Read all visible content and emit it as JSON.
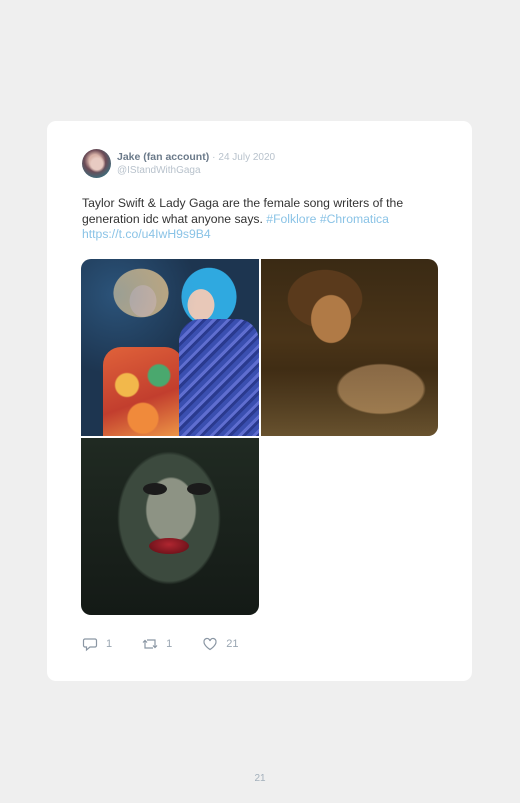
{
  "tweet": {
    "author_name": "Jake (fan account)",
    "separator": "·",
    "date": "24 July 2020",
    "handle": "@IStandWithGaga",
    "text_plain": "Taylor Swift & Lady Gaga are the female song writers of the generation idc what anyone says.",
    "hashtags": [
      "#Folklore",
      "#Chromatica"
    ],
    "link": "https://t.co/u4IwH9s9B4",
    "stats": {
      "replies": "1",
      "retweets": "1",
      "likes": "21"
    },
    "icons": {
      "reply": "reply-icon",
      "retweet": "retweet-icon",
      "like": "heart-icon"
    }
  },
  "page": {
    "number": "21"
  },
  "colors": {
    "background": "#efefef",
    "card": "#ffffff",
    "link": "#8ac3e6",
    "name": "#6b7a8a",
    "muted": "#b8c2cc"
  }
}
